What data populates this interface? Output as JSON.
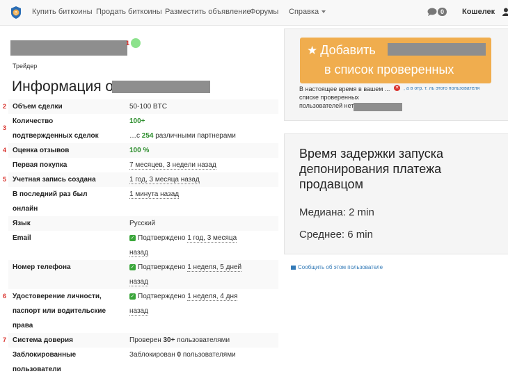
{
  "nav": {
    "items": [
      "Купить биткоины",
      "Продать биткоины",
      "Разместить объявление",
      "Форумы",
      "Справка"
    ],
    "messages_count": "0",
    "wallet": "Кошелек"
  },
  "profile": {
    "marker": "1",
    "role": "Трейдер",
    "heading_prefix": "Информация о"
  },
  "stats": [
    {
      "num": "2",
      "label": "Объем сделки",
      "value": "50-100 BTC"
    },
    {
      "num": "3",
      "label_lines": [
        "Количество",
        "подтвержденных сделок"
      ],
      "value1": "100+",
      "value2_prefix": "…с",
      "value2_count": "254",
      "value2_suffix": "различными партнерами"
    },
    {
      "num": "4",
      "label": "Оценка отзывов",
      "value": "100 %"
    },
    {
      "num": "",
      "label": "Первая покупка",
      "value": "7 месяцев, 3 недели назад"
    },
    {
      "num": "5",
      "label": "Учетная запись создана",
      "value": "1 год, 3 месяца назад"
    },
    {
      "num": "",
      "label_lines": [
        "В последний раз был",
        "онлайн"
      ],
      "value": "1 минута назад"
    },
    {
      "num": "",
      "label": "Язык",
      "value": "Русский"
    },
    {
      "num": "",
      "label": "Email",
      "value_prefix": "Подтверждено",
      "value_lines": [
        "1 год, 3 месяца",
        "назад"
      ]
    },
    {
      "num": "",
      "label": "Номер телефона",
      "value_prefix": "Подтверждено",
      "value_lines": [
        "1 неделя, 5 дней",
        "назад"
      ]
    },
    {
      "num": "6",
      "label_lines": [
        "Удостоверение личности,",
        "паспорт или водительские",
        "права"
      ],
      "value_prefix": "Подтверждено",
      "value_lines": [
        "1 неделя, 4 дня",
        "назад"
      ]
    },
    {
      "num": "7",
      "label": "Система доверия",
      "value_prefix": "Проверен",
      "value_count": "30+",
      "value_suffix": "пользователями"
    },
    {
      "num": "",
      "label_lines": [
        "Заблокированные",
        "пользователи"
      ],
      "value_prefix": "Заблокирован",
      "value_count": "0",
      "value_suffix": "пользователями"
    }
  ],
  "trust_panel": {
    "button_line1": "Добавить",
    "button_line2": "в список проверенных",
    "note_line1": "В настоящее время в вашем ...",
    "note_line2": "списке проверенных",
    "note_line3": "пользователей нет",
    "note_link": ", а в отр. т. ль этого пользователя"
  },
  "escrow": {
    "title": "Время задержки запуска депонирования платежа продавцом",
    "median": "Медиана: 2 min",
    "average": "Среднее: 6 min"
  },
  "report_link": "Сообщить об этом пользователе",
  "colors": {
    "accent": "#f0ad4e",
    "marker": "#d9302b",
    "green": "#2a8c2a",
    "link": "#337ab7"
  }
}
